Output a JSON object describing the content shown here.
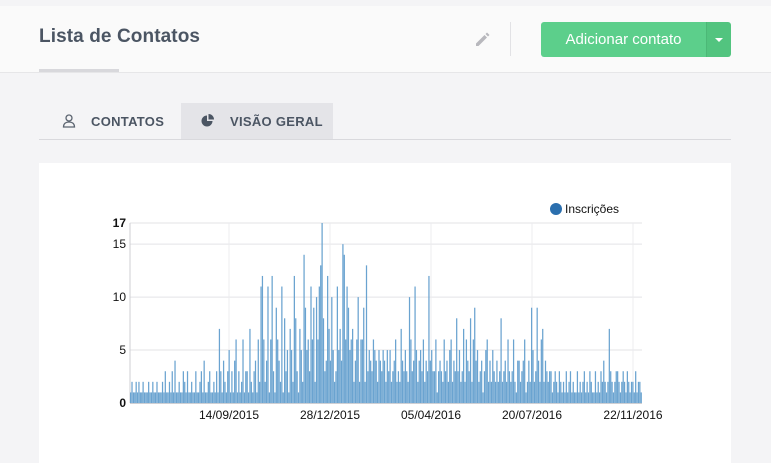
{
  "header": {
    "title": "Lista de Contatos",
    "add_button_label": "Adicionar contato",
    "edit_icon": "pencil-icon",
    "dropdown_icon": "caret-down-icon"
  },
  "tabs": [
    {
      "label": "CONTATOS",
      "icon": "users-icon",
      "active": false
    },
    {
      "label": "VISÃO GERAL",
      "icon": "pie-chart-icon",
      "active": true
    }
  ],
  "colors": {
    "accent_green": "#5ccf8b",
    "series_blue": "#6aa3d0",
    "legend_dot": "#2b6fae"
  },
  "chart_data": {
    "type": "bar",
    "series": [
      {
        "name": "Inscrições"
      }
    ],
    "legend_position": "top-right",
    "ylim": [
      0,
      17
    ],
    "yticks": [
      "0",
      "5",
      "10",
      "15",
      "17"
    ],
    "xticks": [
      "14/09/2015",
      "28/12/2015",
      "05/04/2016",
      "20/07/2016",
      "22/11/2016"
    ],
    "grid": true,
    "values": [
      1,
      2,
      1,
      1,
      2,
      1,
      2,
      1,
      1,
      2,
      1,
      1,
      1,
      2,
      1,
      1,
      2,
      1,
      1,
      2,
      1,
      1,
      1,
      2,
      1,
      3,
      1,
      1,
      2,
      1,
      3,
      1,
      4,
      1,
      1,
      2,
      1,
      1,
      3,
      2,
      1,
      3,
      1,
      1,
      2,
      1,
      1,
      3,
      1,
      1,
      2,
      3,
      1,
      4,
      1,
      1,
      2,
      3,
      1,
      1,
      2,
      1,
      3,
      1,
      7,
      3,
      1,
      4,
      2,
      1,
      3,
      5,
      1,
      3,
      1,
      4,
      6,
      1,
      3,
      1,
      2,
      6,
      1,
      3,
      3,
      1,
      7,
      2,
      1,
      3,
      4,
      1,
      6,
      2,
      11,
      12,
      6,
      2,
      4,
      11,
      1,
      6,
      12,
      3,
      1,
      9,
      6,
      4,
      2,
      11,
      1,
      8,
      3,
      5,
      1,
      7,
      5,
      2,
      12,
      8,
      3,
      1,
      7,
      5,
      2,
      14,
      9,
      5,
      6,
      3,
      11,
      6,
      9,
      2,
      10,
      6,
      11,
      13,
      17,
      8,
      3,
      4,
      12,
      7,
      4,
      10,
      5,
      2,
      3,
      11,
      5,
      7,
      4,
      15,
      14,
      6,
      11,
      9,
      5,
      6,
      7,
      2,
      4,
      6,
      10,
      2,
      6,
      6,
      9,
      2,
      13,
      3,
      5,
      4,
      3,
      6,
      5,
      4,
      2,
      5,
      4,
      3,
      5,
      4,
      2,
      5,
      3,
      5,
      2,
      3,
      4,
      6,
      2,
      3,
      2,
      7,
      4,
      3,
      5,
      3,
      2,
      10,
      6,
      3,
      4,
      11,
      5,
      2,
      4,
      5,
      3,
      6,
      2,
      4,
      3,
      12,
      4,
      5,
      3,
      3,
      6,
      1,
      3,
      4,
      3,
      2,
      6,
      3,
      4,
      2,
      5,
      6,
      2,
      4,
      3,
      8,
      3,
      5,
      2,
      3,
      7,
      2,
      6,
      4,
      3,
      8,
      2,
      6,
      9,
      4,
      5,
      2,
      3,
      4,
      1,
      3,
      5,
      6,
      2,
      4,
      2,
      5,
      3,
      2,
      4,
      2,
      3,
      8,
      2,
      3,
      4,
      2,
      6,
      3,
      2,
      3,
      6,
      2,
      1,
      4,
      4,
      2,
      3,
      4,
      6,
      1,
      2,
      4,
      2,
      9,
      5,
      2,
      3,
      9,
      4,
      2,
      6,
      7,
      2,
      4,
      3,
      2,
      3,
      3,
      1,
      2,
      3,
      2,
      1,
      3,
      2,
      1,
      2,
      1,
      3,
      1,
      2,
      3,
      1,
      2,
      1,
      1,
      3,
      1,
      2,
      1,
      2,
      3,
      1,
      2,
      1,
      3,
      2,
      1,
      1,
      3,
      1,
      2,
      1,
      3,
      2,
      4,
      2,
      1,
      2,
      7,
      3,
      2,
      1,
      2,
      3,
      3,
      2,
      1,
      2,
      3,
      2,
      1,
      3,
      2,
      1,
      2,
      2,
      1,
      3,
      1,
      2,
      2,
      1
    ]
  }
}
